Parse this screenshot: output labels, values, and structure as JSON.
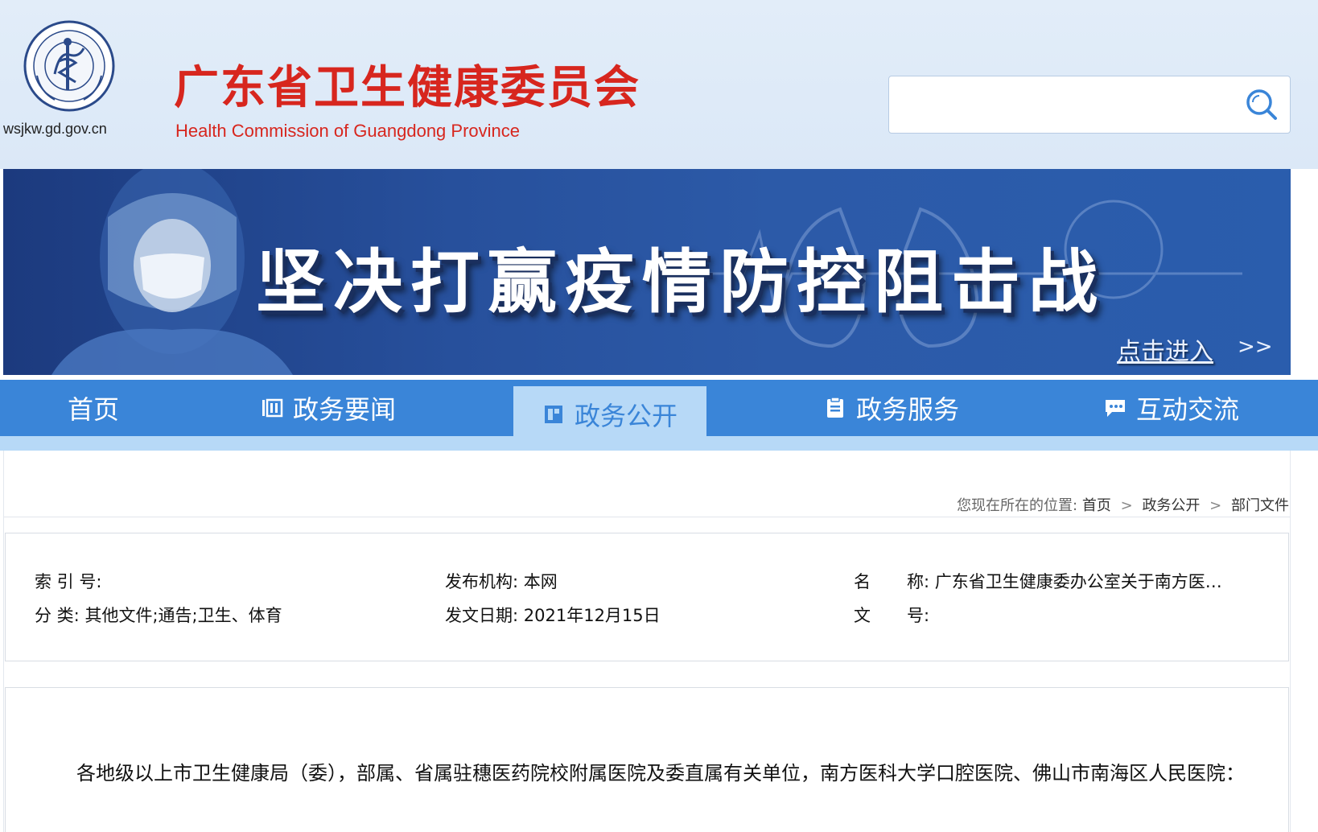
{
  "header": {
    "domain": "wsjkw.gd.gov.cn",
    "title": "广东省卫生健康委员会",
    "subtitle": "Health Commission of Guangdong Province",
    "search_placeholder": ""
  },
  "banner": {
    "title": "坚决打赢疫情防控阻击战",
    "enter_label": "点击进入",
    "enter_arrows": ">>"
  },
  "nav": {
    "items": [
      {
        "label": "首页",
        "icon": "home"
      },
      {
        "label": "政务要闻",
        "icon": "news-icon"
      },
      {
        "label": "政务公开",
        "icon": "disclosure-icon",
        "active": true
      },
      {
        "label": "政务服务",
        "icon": "service-icon"
      },
      {
        "label": "互动交流",
        "icon": "chat-icon"
      }
    ]
  },
  "breadcrumb": {
    "prefix": "您现在所在的位置:",
    "items": [
      "首页",
      "政务公开",
      "部门文件"
    ],
    "separator": ">"
  },
  "meta": {
    "index_label": "索 引 号:",
    "index_value": "",
    "publisher_label": "发布机构:",
    "publisher_value": "本网",
    "name_label_1": "名",
    "name_label_2": "称:",
    "name_value": "广东省卫生健康委办公室关于南方医…",
    "category_label": "分 类:",
    "category_value": "其他文件;通告;卫生、体育",
    "date_label": "发文日期:",
    "date_value": "2021年12月15日",
    "docno_label_1": "文",
    "docno_label_2": "号:",
    "docno_value": ""
  },
  "body": {
    "paragraph": "各地级以上市卫生健康局（委），部属、省属驻穗医药院校附属医院及委直属有关单位，南方医科大学口腔医院、佛山市南海区人民医院："
  },
  "colors": {
    "title_red": "#d7261e",
    "nav_blue": "#3a85d8",
    "nav_active_bg": "#b7d9f7",
    "header_bg": "#e2edf9"
  }
}
